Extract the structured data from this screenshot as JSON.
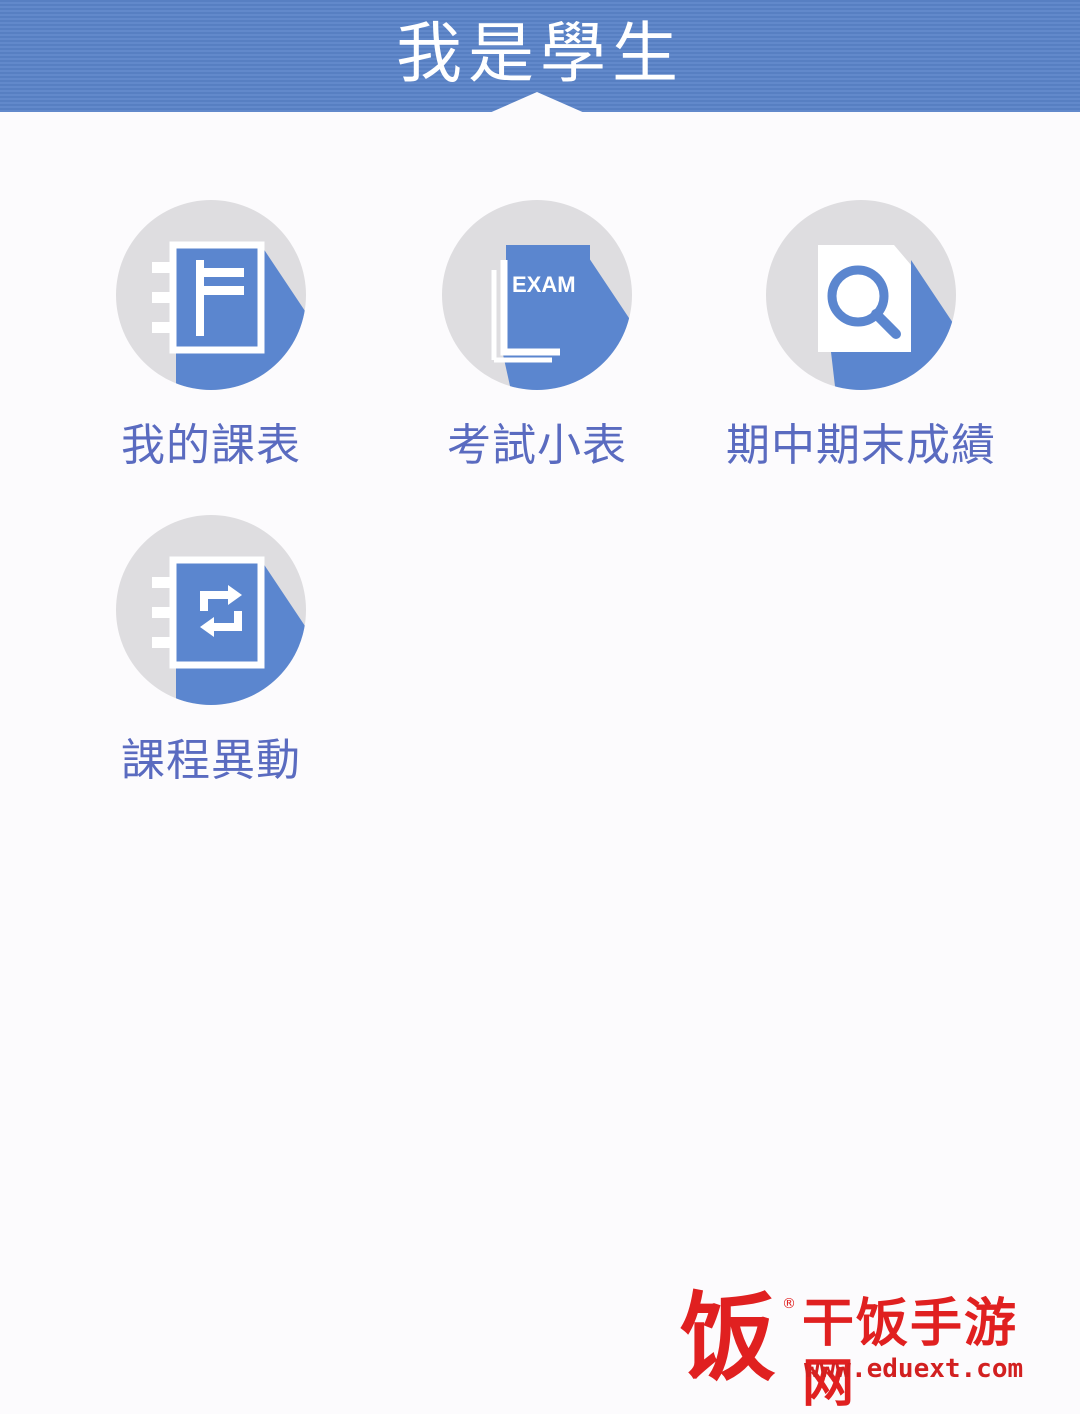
{
  "header": {
    "title": "我是學生"
  },
  "menu": {
    "items": [
      {
        "label": "我的課表",
        "icon": "notebook-icon"
      },
      {
        "label": "考試小表",
        "icon": "exam-paper-icon",
        "icon_text": "EXAM"
      },
      {
        "label": "期中期末成績",
        "icon": "search-document-icon"
      },
      {
        "label": "課程異動",
        "icon": "schedule-change-icon"
      }
    ]
  },
  "watermark": {
    "name": "干饭手游网",
    "url": "www.eduext.com",
    "glyph": "饭",
    "reg": "®"
  },
  "colors": {
    "header": "#5a83c8",
    "icon_blue": "#5b86cf",
    "circle": "#dedde0",
    "label": "#5a6bc0",
    "watermark": "#e02020"
  }
}
